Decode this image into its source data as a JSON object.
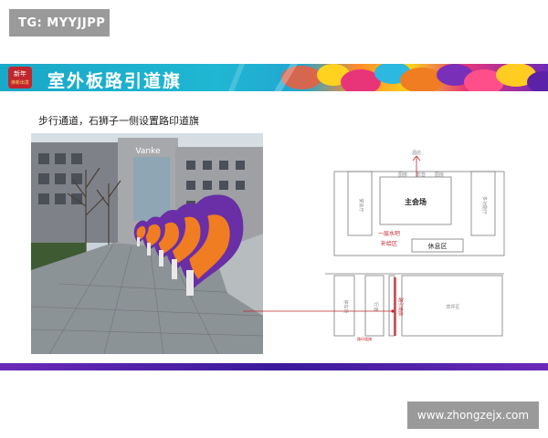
{
  "watermark_top": "TG: MYYJJPP",
  "logo": {
    "line1": "新年",
    "line2": "焕新出发"
  },
  "banner_title": "室外板路引道旗",
  "subtitle": "步行通道，石狮子一侧设置路印道旗",
  "photo": {
    "building_sign": "Vanke"
  },
  "floorplan": {
    "top_labels": [
      "酒店",
      "厨房",
      "影音",
      "厨房"
    ],
    "main_hall": "主会场",
    "bar_area_line1": "一层水吧",
    "bar_area_line2": "补给区",
    "rest_area": "休息区",
    "left_side_room": "宴会厅",
    "right_side_room": "多功能厅",
    "left_lower": "停车场",
    "middle_lower": "行道",
    "route_label": "路引道旗",
    "lower_area": "草坪区",
    "bottom_label": "路印道旗"
  },
  "colors": {
    "banner_teal": "#1fb7d3",
    "banner_purple": "#6b2ab8",
    "accent_red": "#c0262d",
    "flag_orange": "#f07d22",
    "flag_purple": "#6a2fa6"
  },
  "watermark_bottom": "www.zhongzejx.com"
}
